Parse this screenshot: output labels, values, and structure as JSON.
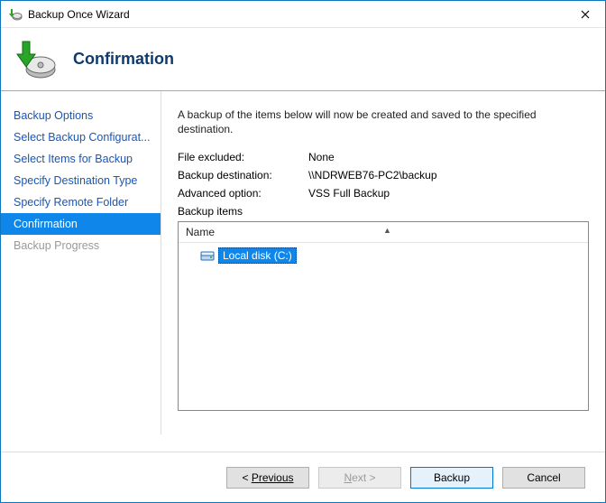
{
  "window": {
    "title": "Backup Once Wizard"
  },
  "header": {
    "title": "Confirmation"
  },
  "sidebar": {
    "steps": [
      {
        "label": "Backup Options",
        "state": "link"
      },
      {
        "label": "Select Backup Configurat...",
        "state": "link"
      },
      {
        "label": "Select Items for Backup",
        "state": "link"
      },
      {
        "label": "Specify Destination Type",
        "state": "link"
      },
      {
        "label": "Specify Remote Folder",
        "state": "link"
      },
      {
        "label": "Confirmation",
        "state": "selected"
      },
      {
        "label": "Backup Progress",
        "state": "disabled"
      }
    ]
  },
  "content": {
    "intro": "A backup of the items below will now be created and saved to the specified destination.",
    "file_excluded_label": "File excluded:",
    "file_excluded_value": "None",
    "destination_label": "Backup destination:",
    "destination_value": "\\\\NDRWEB76-PC2\\backup",
    "advanced_label": "Advanced option:",
    "advanced_value": "VSS Full Backup",
    "backup_items_label": "Backup items",
    "column_name": "Name",
    "items": [
      {
        "label": "Local disk (C:)"
      }
    ]
  },
  "footer": {
    "previous": "Previous",
    "next": "Next",
    "backup": "Backup",
    "cancel": "Cancel"
  }
}
